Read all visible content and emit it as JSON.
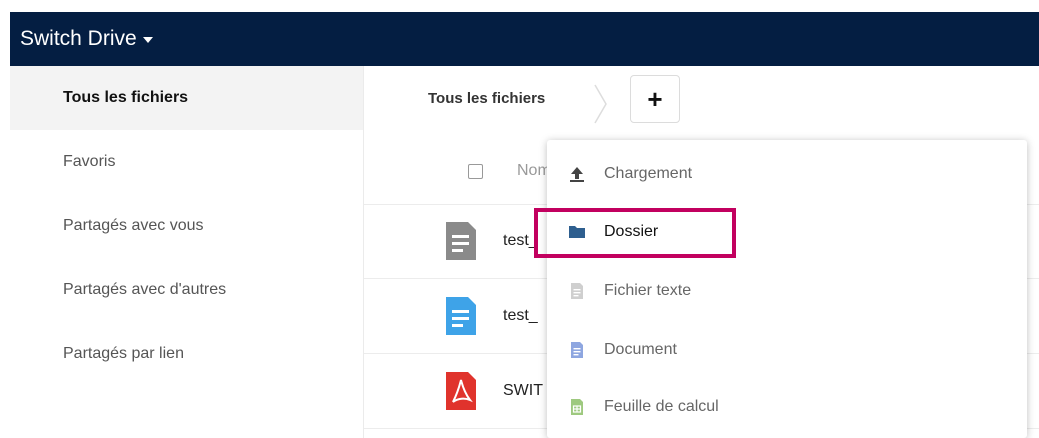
{
  "app": {
    "title": "Switch Drive"
  },
  "sidebar": {
    "items": [
      {
        "label": "Tous les fichiers",
        "active": true
      },
      {
        "label": "Favoris"
      },
      {
        "label": "Partagés avec vous"
      },
      {
        "label": "Partagés avec d'autres"
      },
      {
        "label": "Partagés par lien"
      }
    ]
  },
  "breadcrumb": {
    "label": "Tous les fichiers"
  },
  "toolbar": {
    "new_label": "+"
  },
  "file_list": {
    "header_name": "Nom",
    "rows": [
      {
        "name": "test_",
        "icon": "text-file-icon",
        "color": "#8a8a8a"
      },
      {
        "name": "test_",
        "icon": "document-file-icon",
        "color": "#3ea3e8"
      },
      {
        "name": "SWIT",
        "icon": "pdf-file-icon",
        "color": "#e0332c"
      }
    ]
  },
  "new_menu": {
    "items": [
      {
        "label": "Chargement",
        "icon": "upload-icon"
      },
      {
        "label": "Dossier",
        "icon": "folder-icon",
        "color": "#2e5f8f"
      },
      {
        "label": "Fichier texte",
        "icon": "text-file-icon"
      },
      {
        "label": "Document",
        "icon": "document-icon",
        "color": "#8ea6e0"
      },
      {
        "label": "Feuille de calcul",
        "icon": "spreadsheet-icon",
        "color": "#9ec97f"
      }
    ]
  },
  "colors": {
    "topbar": "#041e42",
    "highlight": "#c2005f",
    "sidebar_active": "#f3f3f3"
  }
}
